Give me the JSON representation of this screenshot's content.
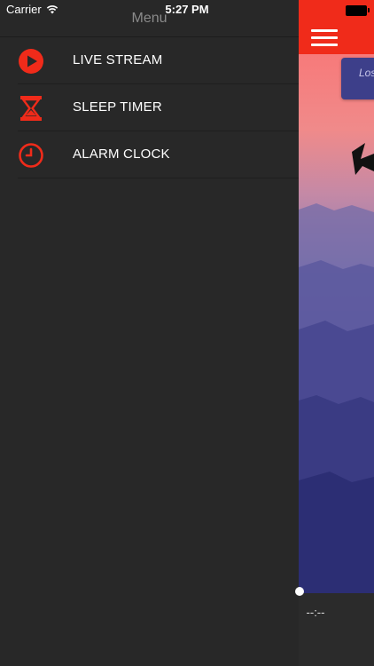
{
  "status_bar": {
    "carrier": "Carrier",
    "time": "5:27 PM"
  },
  "menu": {
    "title": "Menu",
    "items": [
      {
        "label": "LIVE STREAM",
        "icon": "play-circle-icon"
      },
      {
        "label": "SLEEP TIMER",
        "icon": "hourglass-icon"
      },
      {
        "label": "ALARM CLOCK",
        "icon": "clock-icon"
      }
    ]
  },
  "player": {
    "elapsed_time": "--:--",
    "logo_text": "Los"
  },
  "colors": {
    "accent": "#f02b1a",
    "menu_background": "#282828",
    "menu_title": "#8a8a8a"
  }
}
